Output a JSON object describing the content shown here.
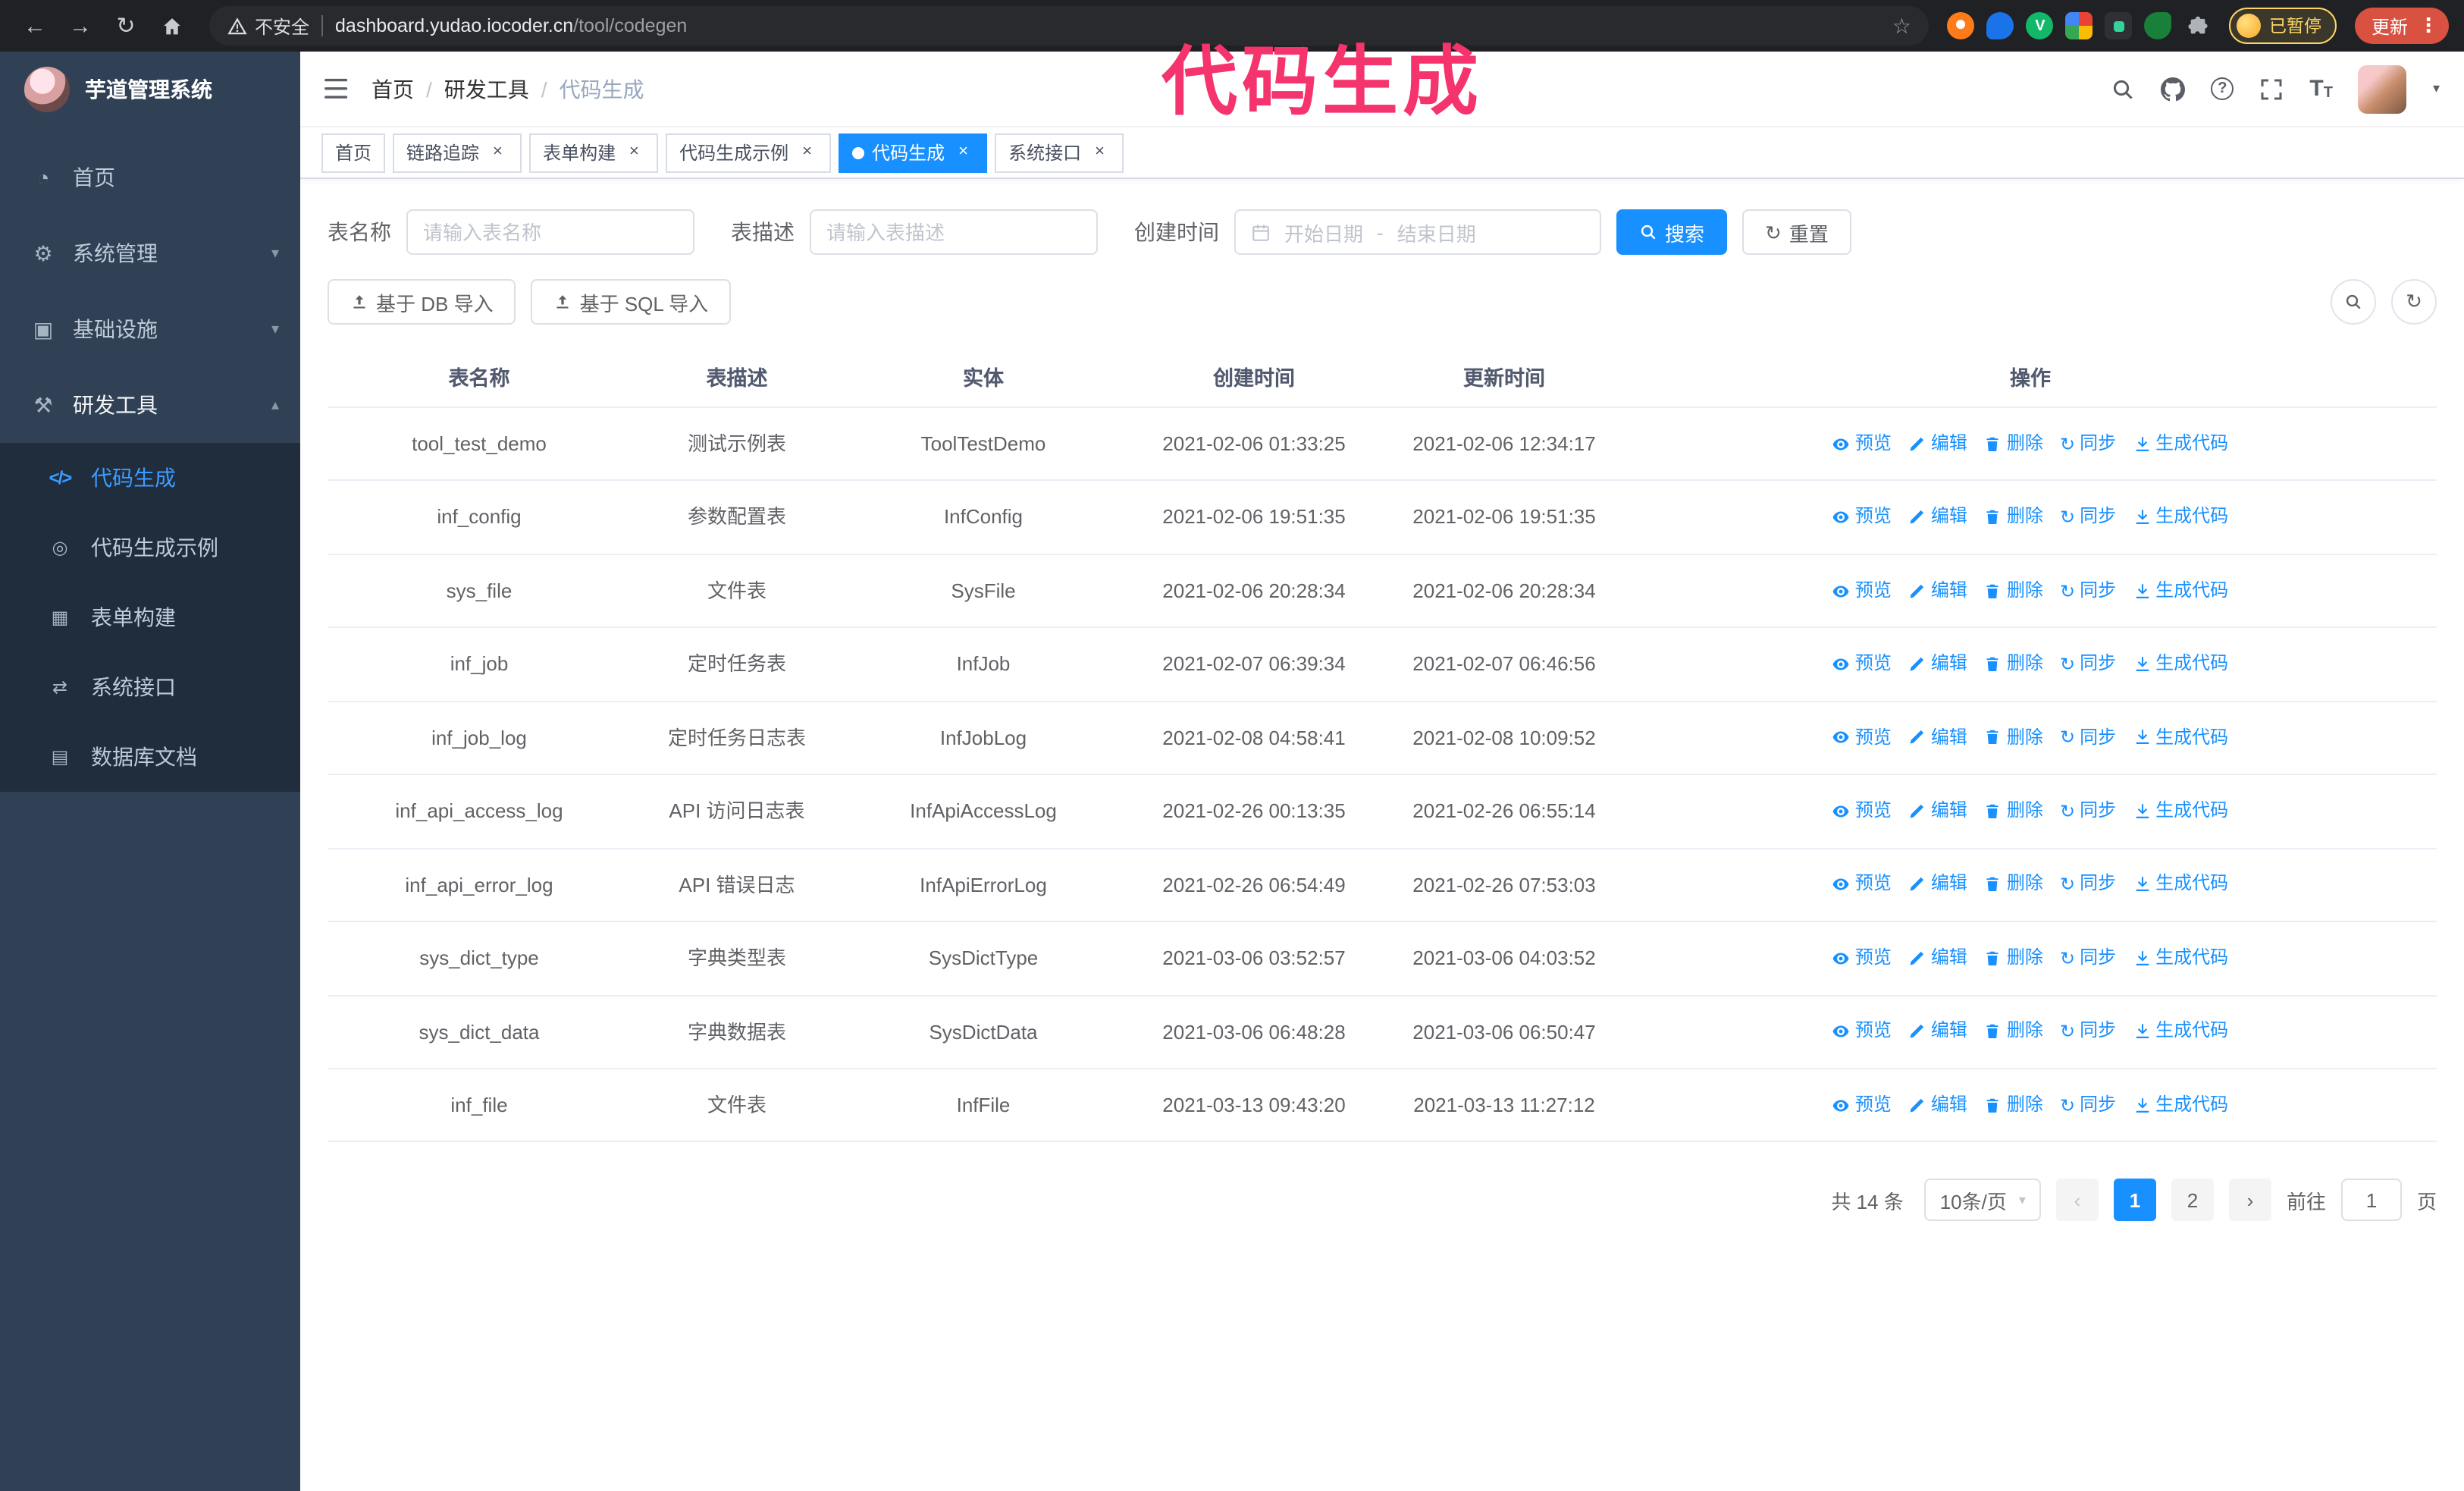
{
  "annotation": {
    "text": "代码生成"
  },
  "browser": {
    "security_label": "不安全",
    "url_domain": "dashboard.yudao.iocoder.cn",
    "url_path": "/tool/codegen",
    "profile_badge": "已暂停",
    "update_button": "更新"
  },
  "icons": {
    "back": "←",
    "forward": "→",
    "reload": "↻",
    "star": "☆",
    "kebab": "⋮",
    "close": "×",
    "chevron_down": "▾",
    "chevron_up": "▴",
    "caret_down": "▾",
    "dash": "-",
    "sync": "↻",
    "prev": "‹",
    "next": "›",
    "ext_v": "V",
    "menu_home": "◔",
    "menu_system": "⚙",
    "menu_infra": "▣",
    "menu_tools": "⚒",
    "menu_codegen": "</>",
    "menu_example": "◎",
    "menu_form": "▦",
    "menu_api": "⇄",
    "menu_db": "▤"
  },
  "sidebar": {
    "logo_title": "芋道管理系统",
    "items": [
      {
        "label": "首页"
      },
      {
        "label": "系统管理"
      },
      {
        "label": "基础设施"
      },
      {
        "label": "研发工具"
      }
    ],
    "sub_items": [
      {
        "label": "代码生成",
        "active": true
      },
      {
        "label": "代码生成示例"
      },
      {
        "label": "表单构建"
      },
      {
        "label": "系统接口"
      },
      {
        "label": "数据库文档"
      }
    ]
  },
  "breadcrumb": {
    "separator": "/",
    "items": [
      "首页",
      "研发工具",
      "代码生成"
    ]
  },
  "tabs": [
    {
      "label": "首页",
      "closable": false
    },
    {
      "label": "链路追踪",
      "closable": true
    },
    {
      "label": "表单构建",
      "closable": true
    },
    {
      "label": "代码生成示例",
      "closable": true
    },
    {
      "label": "代码生成",
      "closable": true,
      "active": true
    },
    {
      "label": "系统接口",
      "closable": true
    }
  ],
  "filters": {
    "table_name_label": "表名称",
    "table_name_placeholder": "请输入表名称",
    "table_desc_label": "表描述",
    "table_desc_placeholder": "请输入表描述",
    "create_time_label": "创建时间",
    "date_start_placeholder": "开始日期",
    "date_separator": "-",
    "date_end_placeholder": "结束日期",
    "search_button": "搜索",
    "reset_button": "重置"
  },
  "toolbar": {
    "import_db_button": "基于 DB 导入",
    "import_sql_button": "基于 SQL 导入"
  },
  "table": {
    "columns": [
      "表名称",
      "表描述",
      "实体",
      "创建时间",
      "更新时间",
      "操作"
    ],
    "actions": [
      "预览",
      "编辑",
      "删除",
      "同步",
      "生成代码"
    ],
    "rows": [
      {
        "name": "tool_test_demo",
        "desc": "测试示例表",
        "entity": "ToolTestDemo",
        "created": "2021-02-06 01:33:25",
        "updated": "2021-02-06 12:34:17"
      },
      {
        "name": "inf_config",
        "desc": "参数配置表",
        "entity": "InfConfig",
        "created": "2021-02-06 19:51:35",
        "updated": "2021-02-06 19:51:35"
      },
      {
        "name": "sys_file",
        "desc": "文件表",
        "entity": "SysFile",
        "created": "2021-02-06 20:28:34",
        "updated": "2021-02-06 20:28:34"
      },
      {
        "name": "inf_job",
        "desc": "定时任务表",
        "entity": "InfJob",
        "created": "2021-02-07 06:39:34",
        "updated": "2021-02-07 06:46:56"
      },
      {
        "name": "inf_job_log",
        "desc": "定时任务日志表",
        "entity": "InfJobLog",
        "created": "2021-02-08 04:58:41",
        "updated": "2021-02-08 10:09:52"
      },
      {
        "name": "inf_api_access_log",
        "desc": "API 访问日志表",
        "entity": "InfApiAccessLog",
        "created": "2021-02-26 00:13:35",
        "updated": "2021-02-26 06:55:14"
      },
      {
        "name": "inf_api_error_log",
        "desc": "API 错误日志",
        "entity": "InfApiErrorLog",
        "created": "2021-02-26 06:54:49",
        "updated": "2021-02-26 07:53:03"
      },
      {
        "name": "sys_dict_type",
        "desc": "字典类型表",
        "entity": "SysDictType",
        "created": "2021-03-06 03:52:57",
        "updated": "2021-03-06 04:03:52"
      },
      {
        "name": "sys_dict_data",
        "desc": "字典数据表",
        "entity": "SysDictData",
        "created": "2021-03-06 06:48:28",
        "updated": "2021-03-06 06:50:47"
      },
      {
        "name": "inf_file",
        "desc": "文件表",
        "entity": "InfFile",
        "created": "2021-03-13 09:43:20",
        "updated": "2021-03-13 11:27:12"
      }
    ]
  },
  "pagination": {
    "total": "共 14 条",
    "page_size": "10条/页",
    "pages": [
      "1",
      "2"
    ],
    "active_page": "1",
    "goto_label": "前往",
    "goto_value": "1",
    "goto_unit": "页"
  },
  "colors": {
    "accent": "#1890ff",
    "sidebar_bg": "#304156",
    "submenu_bg": "#1f2d3d",
    "browser_bar_bg": "#202124",
    "annotation_pink": "#f5336c",
    "update_button_red": "#d95140",
    "paused_badge_yellow": "#fdd663"
  }
}
